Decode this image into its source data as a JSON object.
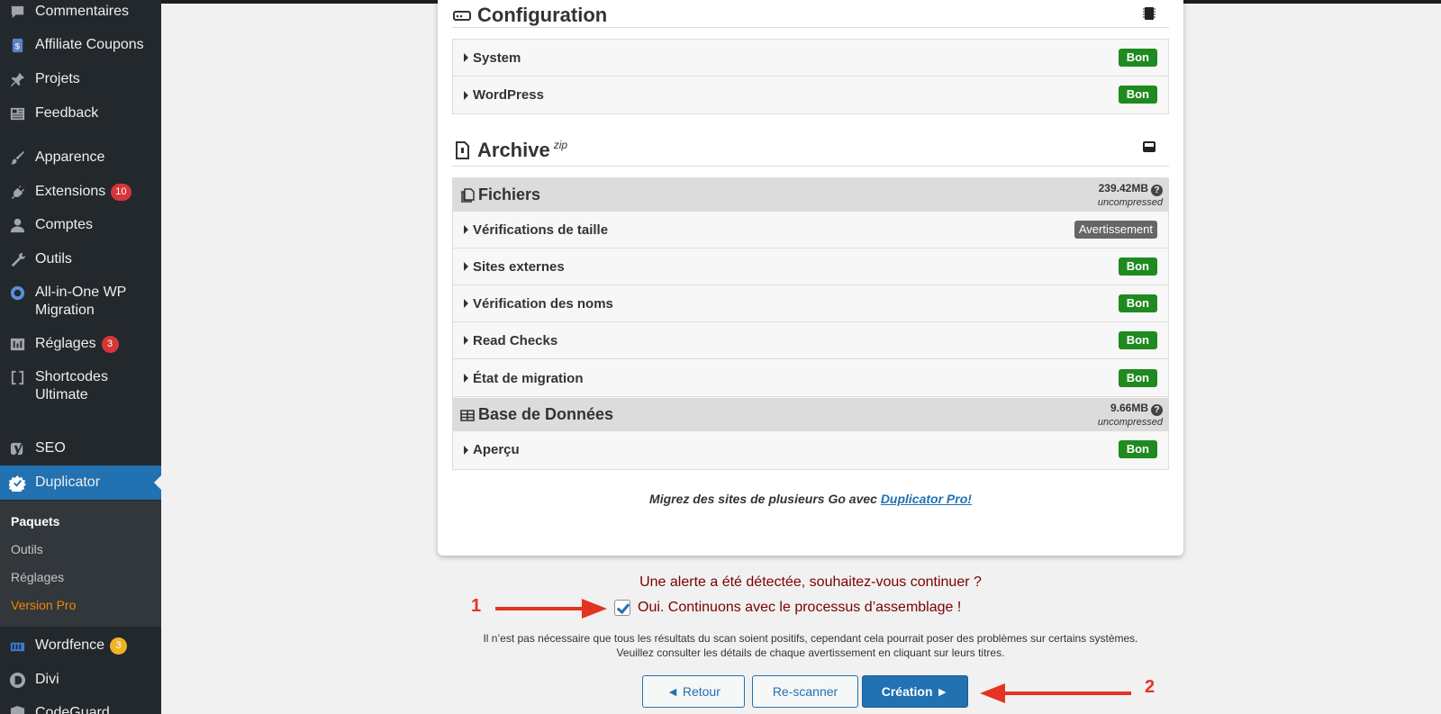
{
  "sidebar": {
    "items": [
      {
        "label": "Commentaires",
        "icon": "comment-icon"
      },
      {
        "label": "Affiliate Coupons",
        "icon": "coupon-icon"
      },
      {
        "label": "Projets",
        "icon": "pin-icon"
      },
      {
        "label": "Feedback",
        "icon": "feedback-icon"
      },
      {
        "label": "Apparence",
        "icon": "paintbrush-icon"
      },
      {
        "label": "Extensions",
        "icon": "plugin-icon",
        "badge": "10"
      },
      {
        "label": "Comptes",
        "icon": "user-icon"
      },
      {
        "label": "Outils",
        "icon": "wrench-icon"
      },
      {
        "label": "All-in-One WP",
        "label2": "Migration",
        "icon": "migration-icon"
      },
      {
        "label": "Réglages",
        "icon": "settings-icon",
        "badge": "3"
      },
      {
        "label": "Shortcodes",
        "label2": "Ultimate",
        "icon": "brackets-icon"
      },
      {
        "label": "SEO",
        "icon": "yoast-icon"
      },
      {
        "label": "Duplicator",
        "icon": "duplicator-icon"
      },
      {
        "label": "Wordfence",
        "icon": "wordfence-icon",
        "badge": "3"
      },
      {
        "label": "Divi",
        "icon": "divi-icon"
      },
      {
        "label": "CodeGuard",
        "icon": "shield-icon"
      }
    ],
    "submenu": [
      "Paquets",
      "Outils",
      "Réglages",
      "Version Pro"
    ]
  },
  "configuration": {
    "title": "Configuration",
    "rows": [
      {
        "label": "System",
        "status": "Bon"
      },
      {
        "label": "WordPress",
        "status": "Bon"
      }
    ]
  },
  "archive": {
    "title": "Archive",
    "suffix": "zip",
    "files": {
      "title": "Fichiers",
      "size": "239.42MB",
      "size_note": "uncompressed",
      "rows": [
        {
          "label": "Vérifications de taille",
          "status": "Avertissement"
        },
        {
          "label": "Sites externes",
          "status": "Bon"
        },
        {
          "label": "Vérification des noms",
          "status": "Bon"
        },
        {
          "label": "Read Checks",
          "status": "Bon"
        },
        {
          "label": "État de migration",
          "status": "Bon"
        }
      ]
    },
    "database": {
      "title": "Base de Données",
      "size": "9.66MB",
      "size_note": "uncompressed",
      "rows": [
        {
          "label": "Aperçu",
          "status": "Bon"
        }
      ]
    }
  },
  "promo": {
    "text": "Migrez des sites de plusieurs Go avec ",
    "link": "Duplicator Pro!"
  },
  "alert": {
    "question": "Une alerte a été détectée, souhaitez-vous continuer ?",
    "confirm": "Oui. Continuons avec le processus d’assemblage !",
    "checked": true,
    "note_line1": "Il n’est pas nécessaire que tous les résultats du scan soient positifs, cependant cela pourrait poser des problèmes sur certains systèmes.",
    "note_line2": "Veuillez consulter les détails de chaque avertissement en cliquant sur leurs titres."
  },
  "buttons": {
    "back": "◄ Retour",
    "rescan": "Re-scanner",
    "create": "Création ►"
  },
  "annotations": {
    "one": "1",
    "two": "2"
  },
  "colors": {
    "accent": "#2271b1",
    "good": "#1f8a1f",
    "annotation": "#e53322",
    "alert": "#7a0000"
  }
}
